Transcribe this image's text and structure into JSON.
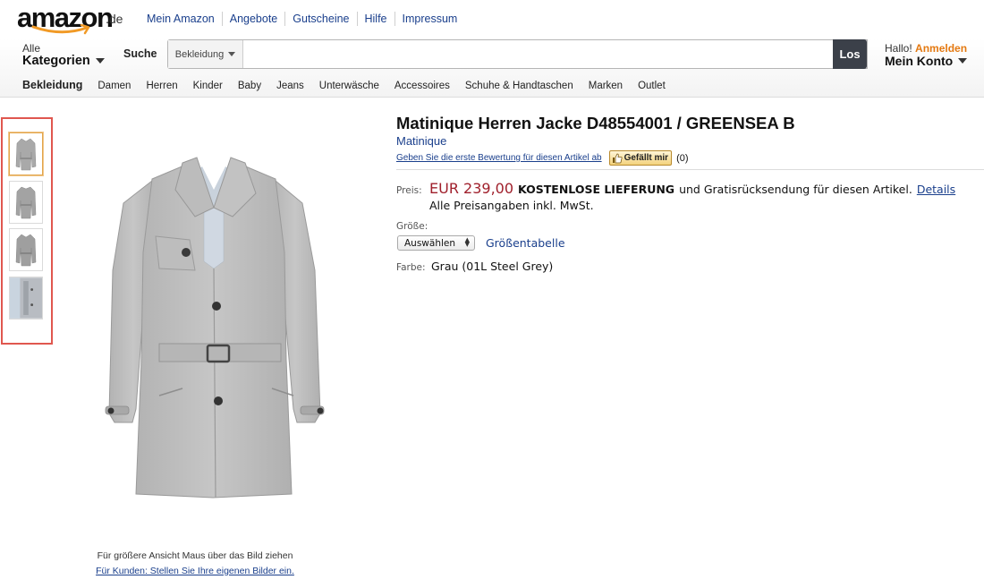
{
  "header": {
    "logo_text": "amazon",
    "logo_tld": ".de",
    "top_links": [
      "Mein Amazon",
      "Angebote",
      "Gutscheine",
      "Hilfe",
      "Impressum"
    ],
    "categories_small": "Alle",
    "categories_big": "Kategorien",
    "search_label": "Suche",
    "search_category": "Bekleidung",
    "search_value": "",
    "search_button": "Los",
    "account_hello": "Hallo!",
    "account_signin": "Anmelden",
    "account_label": "Mein Konto"
  },
  "subnav": {
    "title": "Bekleidung",
    "items": [
      "Damen",
      "Herren",
      "Kinder",
      "Baby",
      "Jeans",
      "Unterwäsche",
      "Accessoires",
      "Schuhe & Handtaschen",
      "Marken",
      "Outlet"
    ]
  },
  "gallery": {
    "hover_hint": "Für größere Ansicht Maus über das Bild ziehen",
    "customer_images_link": "Für Kunden: Stellen Sie Ihre eigenen Bilder ein.",
    "selected_thumbnail": 1
  },
  "product": {
    "title": "Matinique Herren Jacke D48554001 / GREENSEA B",
    "brand": "Matinique",
    "review_link": "Geben Sie die erste Bewertung für diesen Artikel ab",
    "like_button": "Gefällt mir",
    "like_count": "(0)",
    "price_label": "Preis:",
    "price": "EUR 239,00",
    "free_shipping": "KOSTENLOSE LIEFERUNG",
    "shipping_rest": "und Gratisrücksendung für diesen Artikel.",
    "details_link": "Details",
    "price_note": "Alle Preisangaben inkl. MwSt.",
    "size_label": "Größe:",
    "size_select": "Auswählen",
    "size_chart_link": "Größentabelle",
    "color_label": "Farbe:",
    "color_value": "Grau (01L Steel Grey)"
  },
  "colors": {
    "link": "#1a3f8c",
    "price": "#a0202c",
    "accent_orange": "#e47911",
    "highlight_frame": "#e0574f",
    "search_button": "#3b4049"
  }
}
